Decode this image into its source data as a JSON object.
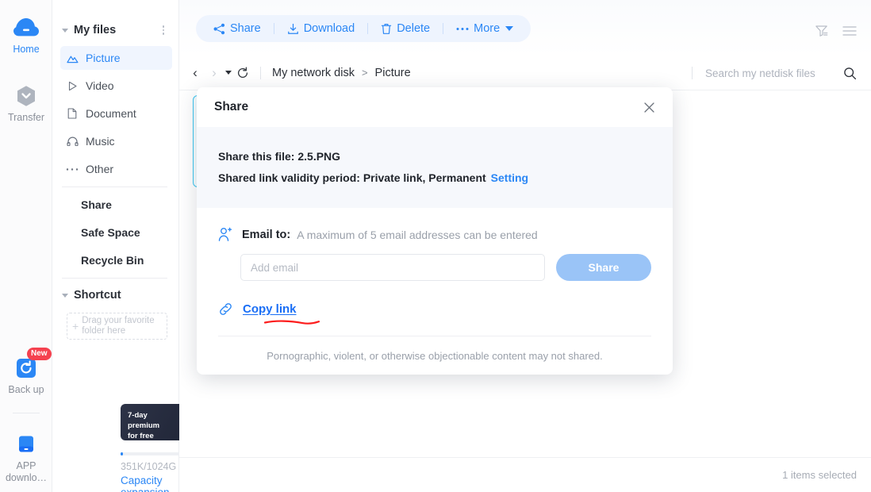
{
  "rail": {
    "items": [
      {
        "label": "Home",
        "icon": "cloud-icon",
        "active": true,
        "badge": null
      },
      {
        "label": "Transfer",
        "icon": "transfer-icon",
        "active": false,
        "badge": null
      },
      {
        "label": "Back up",
        "icon": "backup-icon",
        "active": false,
        "badge": "New"
      },
      {
        "label": "APP downlo…",
        "icon": "device-icon",
        "active": false,
        "badge": null
      }
    ]
  },
  "sidebar": {
    "group_title": "My files",
    "kebab_name": "more-options",
    "nav": [
      {
        "label": "Picture",
        "icon": "picture-icon",
        "active": true
      },
      {
        "label": "Video",
        "icon": "video-icon",
        "active": false
      },
      {
        "label": "Document",
        "icon": "document-icon",
        "active": false
      },
      {
        "label": "Music",
        "icon": "music-icon",
        "active": false
      },
      {
        "label": "Other",
        "icon": "other-icon",
        "active": false
      }
    ],
    "links": [
      {
        "label": "Share"
      },
      {
        "label": "Safe Space"
      },
      {
        "label": "Recycle Bin"
      }
    ],
    "shortcut_title": "Shortcut",
    "drop_zone_text": "Drag your favorite folder here",
    "promo": {
      "line1": "7-day premium",
      "line2": "for free",
      "gift_icon": "gift-icon",
      "close_icon": "close-icon"
    },
    "capacity_text": "351K/1024G",
    "capacity_link": "Capacity expansion",
    "capacity_percent": 2
  },
  "toolbar": {
    "buttons": [
      {
        "label": "Share",
        "icon": "share-icon"
      },
      {
        "label": "Download",
        "icon": "download-icon"
      },
      {
        "label": "Delete",
        "icon": "trash-icon"
      },
      {
        "label": "More",
        "icon": "ellipsis-icon"
      }
    ],
    "right_icons": [
      {
        "name": "filter-icon"
      },
      {
        "name": "list-view-icon"
      }
    ]
  },
  "breadcrumb": {
    "back_icon": "chevron-left-icon",
    "forward_icon": "chevron-right-icon",
    "history_icon": "caret-down-icon",
    "refresh_icon": "refresh-icon",
    "root": "My network disk",
    "separator": ">",
    "current": "Picture"
  },
  "search": {
    "placeholder": "Search my netdisk files",
    "value": "",
    "icon": "search-icon"
  },
  "status": {
    "selected_text": "1 items selected"
  },
  "dialog": {
    "title": "Share",
    "close_icon": "close-icon",
    "info_line1": "Share this file: 2.5.PNG",
    "info_line2": "Shared link validity period: Private link, Permanent",
    "setting_link": "Setting",
    "email_icon": "add-person-icon",
    "email_label": "Email to:",
    "email_hint": "A maximum of 5 email addresses can be entered",
    "email_placeholder": "Add email",
    "email_value": "",
    "share_button": "Share",
    "copy_icon": "link-icon",
    "copy_link": "Copy link",
    "footer_note": "Pornographic, violent, or otherwise objectionable content may not shared.",
    "accent_color": "#2b87f5",
    "share_button_color": "#9ac4f7",
    "annotation_color": "#fc1c1c"
  }
}
